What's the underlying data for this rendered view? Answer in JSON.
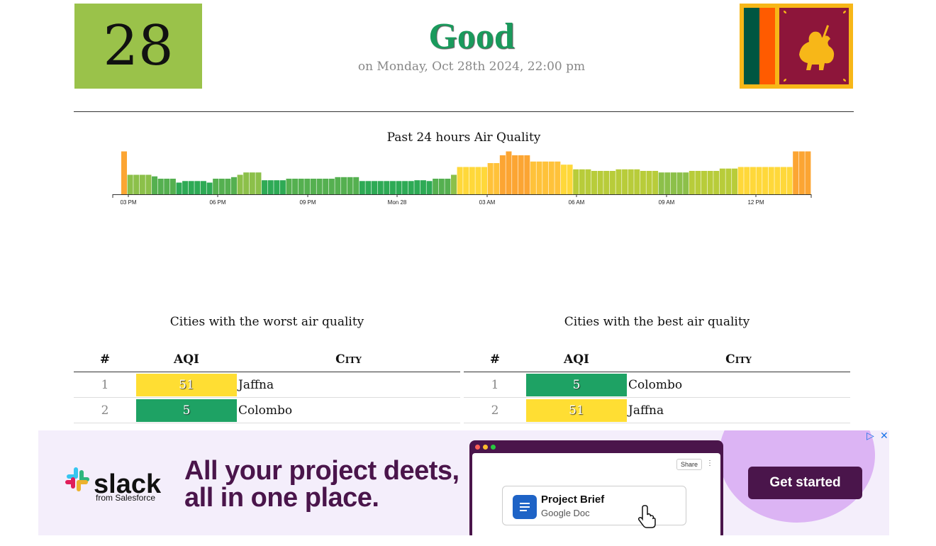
{
  "current": {
    "aqi": "28",
    "aqi_color": "#9ac24a",
    "status": "Good",
    "status_color": "#1a9a5c",
    "date": "on Monday, Oct 28th 2024, 22:00 pm"
  },
  "flag": {
    "icon": "sri-lanka-flag"
  },
  "chart_data": {
    "type": "bar",
    "title": "Past 24 hours Air Quality",
    "x_tick_labels": [
      "03 PM",
      "06 PM",
      "09 PM",
      "Mon 28",
      "03 AM",
      "06 AM",
      "09 AM",
      "12 PM"
    ],
    "ylim": [
      0,
      60
    ],
    "values": [
      55,
      25,
      25,
      25,
      25,
      23,
      20,
      20,
      20,
      15,
      17,
      17,
      17,
      17,
      15,
      20,
      20,
      20,
      22,
      25,
      28,
      28,
      28,
      18,
      18,
      18,
      18,
      20,
      20,
      20,
      20,
      20,
      20,
      20,
      20,
      22,
      22,
      22,
      22,
      17,
      17,
      17,
      17,
      17,
      17,
      17,
      17,
      17,
      18,
      18,
      17,
      20,
      20,
      20,
      25,
      35,
      35,
      35,
      35,
      35,
      40,
      40,
      50,
      55,
      50,
      50,
      50,
      42,
      42,
      42,
      42,
      42,
      38,
      38,
      32,
      32,
      32,
      30,
      30,
      30,
      30,
      32,
      32,
      32,
      32,
      30,
      30,
      30,
      28,
      28,
      28,
      28,
      28,
      30,
      30,
      30,
      30,
      30,
      33,
      33,
      33,
      35,
      35,
      35,
      35,
      35,
      35,
      35,
      35,
      35,
      55,
      55,
      55
    ],
    "colors": {
      "good_dark": "#2eaa55",
      "good_mid": "#55b050",
      "good_light": "#8cc04a",
      "moderate_low": "#b8cc3a",
      "moderate": "#ffd83a",
      "moderate_high": "#ffc23a",
      "unhealthy_sensitive": "#fca533"
    }
  },
  "worst": {
    "title": "Cities with the worst air quality",
    "headers": {
      "rank": "#",
      "aqi": "AQI",
      "city": "City"
    },
    "rows": [
      {
        "rank": "1",
        "aqi": "51",
        "city": "Jaffna",
        "color": "#ffde33"
      },
      {
        "rank": "2",
        "aqi": "5",
        "city": "Colombo",
        "color": "#1ea264"
      }
    ]
  },
  "best": {
    "title": "Cities with the best air quality",
    "headers": {
      "rank": "#",
      "aqi": "AQI",
      "city": "City"
    },
    "rows": [
      {
        "rank": "1",
        "aqi": "5",
        "city": "Colombo",
        "color": "#1ea264"
      },
      {
        "rank": "2",
        "aqi": "51",
        "city": "Jaffna",
        "color": "#ffde33"
      }
    ]
  },
  "ad": {
    "brand": "slack",
    "brand_sub": "from Salesforce",
    "headline_1": "All your project deets,",
    "headline_2": "all in one place.",
    "share": "Share",
    "doc_title": "Project Brief",
    "doc_sub": "Google Doc",
    "cta": "Get started",
    "choices_icon": "ad-choices-icon",
    "close_icon": "close-icon"
  }
}
